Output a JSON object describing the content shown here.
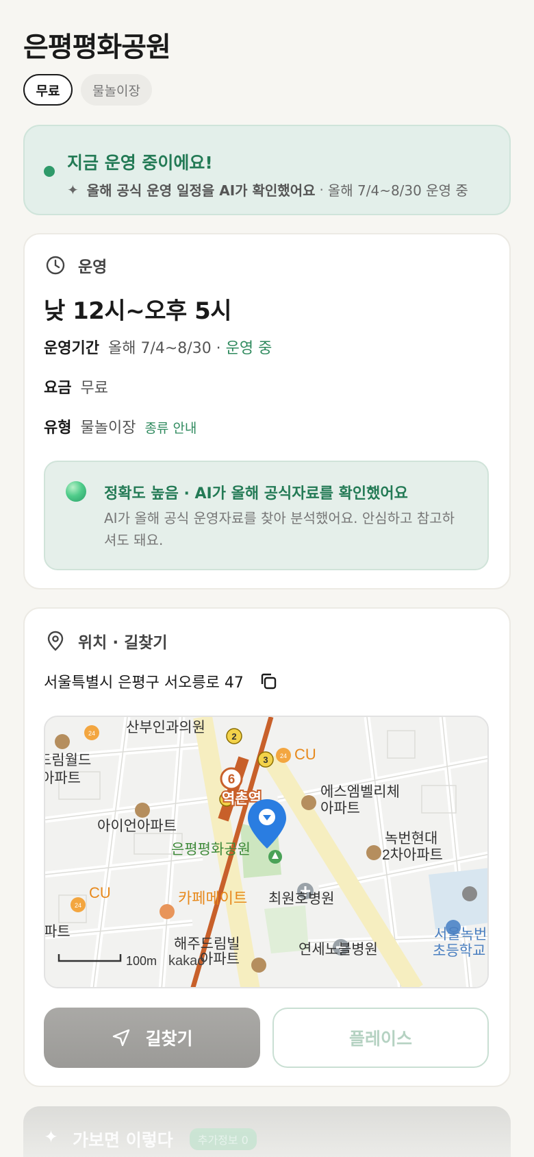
{
  "page": {
    "title": "은평평화공원",
    "chips": [
      "무료",
      "물놀이장"
    ]
  },
  "status": {
    "title": "지금 운영 중이에요!",
    "sub_bold": "올해 공식 운영 일정을 AI가 확인했어요",
    "sub_sep": "·",
    "sub_extra": "올해 7/4~8/30 운영 중",
    "dot_color": "#2f9a6a"
  },
  "operation": {
    "section_label": "운영",
    "hours": "낮 12시~오후 5시",
    "period_label": "운영기간",
    "period_value": "올해 7/4~8/30 ·",
    "period_status": "운영 중",
    "fee_label": "요금",
    "fee_value": "무료",
    "type_label": "유형",
    "type_value": "물놀이장",
    "type_link": "종류 안내",
    "ai_title": "정확도 높음 · AI가 올해 공식자료를 확인했어요",
    "ai_desc": "AI가 올해 공식 운영자료를 찾아 분석했어요. 안심하고 참고하셔도 돼요."
  },
  "location": {
    "section_label": "위치 · 길찾기",
    "address": "서울특별시 은평구 서오릉로 47",
    "map": {
      "labels": {
        "hospital_top": "산부인과의원",
        "apt_left1": "드림월드",
        "apt_left1b": "아파트",
        "cu_top": "CU",
        "apt_smb": "에스엠벨리체",
        "apt_smb2": "아파트",
        "station": "역촌역",
        "apt_iron": "아이언아파트",
        "apt_nokbeon": "녹번현대",
        "apt_nokbeon2": "2차아파트",
        "park": "은평평화공원",
        "cu_left": "CU",
        "cafe": "카페메이트",
        "hospital_choi": "최원호병원",
        "apt_partial": "파트",
        "apt_haeju": "해주드림빌",
        "apt_haeju2": "아파트",
        "hospital_yonsei": "연세노블병원",
        "school": "서울녹번",
        "school2": "초등학교",
        "scale": "100m",
        "logo": "kakao",
        "line_no": "6",
        "bus_2": "2",
        "bus_3": "3",
        "badge_24a": "24",
        "badge_24b": "24",
        "badge_24c": "24"
      }
    },
    "btn_route": "길찾기",
    "btn_place": "플레이스"
  },
  "more": {
    "title": "가보면 이렇다",
    "badge": "추가정보 0"
  },
  "colors": {
    "accent_green": "#2f8a5e",
    "status_bg": "#e3efea",
    "pin_blue": "#2a7de1",
    "subway_brown": "#c8602a"
  }
}
